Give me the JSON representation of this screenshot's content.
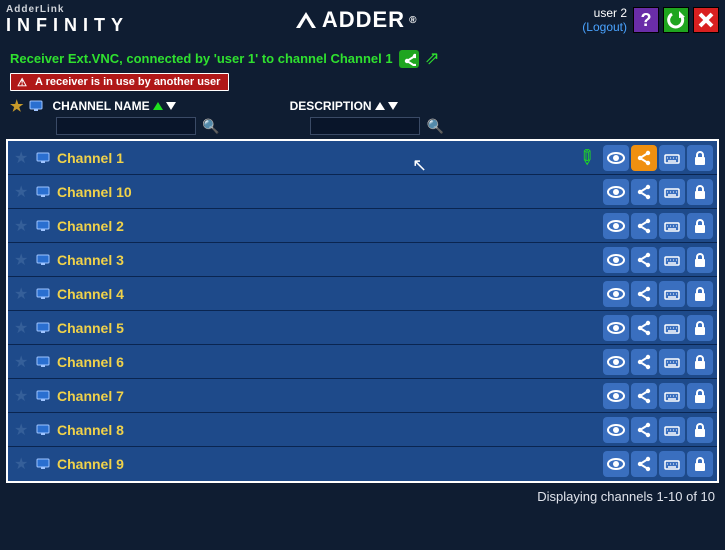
{
  "brand": {
    "top": "AdderLink",
    "bottom": "INFINITY",
    "center": "ADDER",
    "trademark": "®"
  },
  "user": {
    "name": "user 2",
    "logout_label": "(Logout)"
  },
  "status": {
    "text": "Receiver Ext.VNC, connected by 'user 1' to channel Channel 1"
  },
  "warning": {
    "text": "A receiver is in use by another user"
  },
  "columns": {
    "channel_label": "CHANNEL NAME",
    "description_label": "DESCRIPTION"
  },
  "filters": {
    "channel_value": "",
    "description_value": ""
  },
  "channels": [
    {
      "name": "Channel 1",
      "editing": true,
      "share_highlight": true
    },
    {
      "name": "Channel 10",
      "editing": false,
      "share_highlight": false
    },
    {
      "name": "Channel 2",
      "editing": false,
      "share_highlight": false
    },
    {
      "name": "Channel 3",
      "editing": false,
      "share_highlight": false
    },
    {
      "name": "Channel 4",
      "editing": false,
      "share_highlight": false
    },
    {
      "name": "Channel 5",
      "editing": false,
      "share_highlight": false
    },
    {
      "name": "Channel 6",
      "editing": false,
      "share_highlight": false
    },
    {
      "name": "Channel 7",
      "editing": false,
      "share_highlight": false
    },
    {
      "name": "Channel 8",
      "editing": false,
      "share_highlight": false
    },
    {
      "name": "Channel 9",
      "editing": false,
      "share_highlight": false
    }
  ],
  "footer": {
    "text": "Displaying channels 1-10 of 10"
  }
}
